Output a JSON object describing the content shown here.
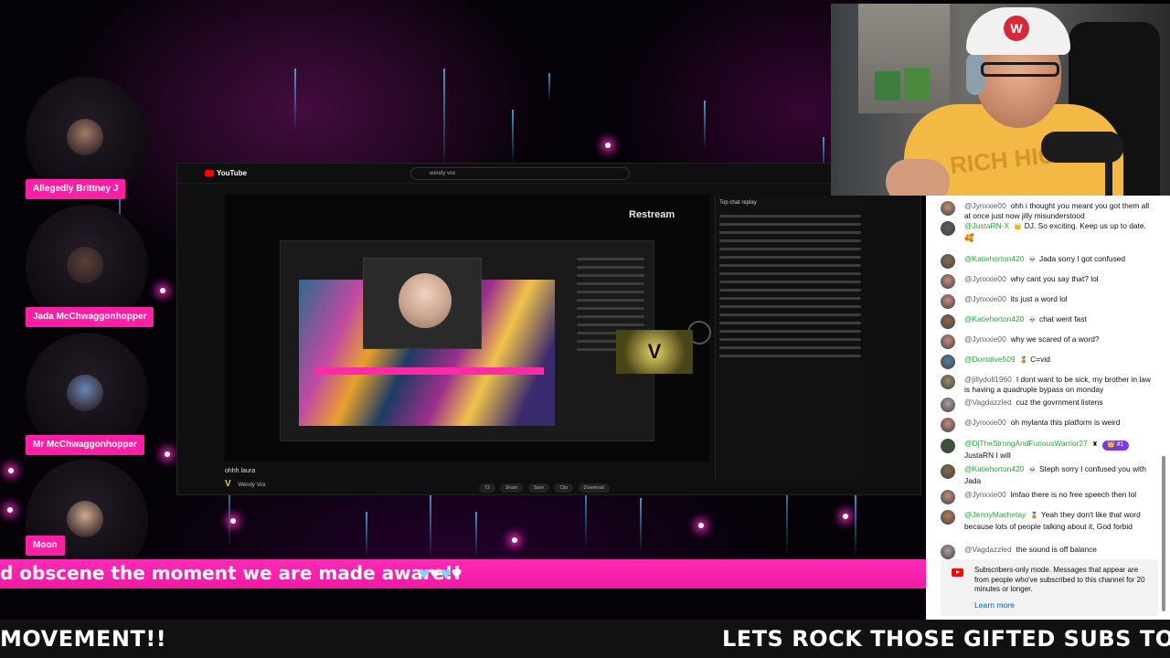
{
  "guests": [
    {
      "name": "Allegedly Brittney J",
      "face_color": "#a37b65"
    },
    {
      "name": "Jada McChwaggonhopper",
      "face_color": "#5a4038"
    },
    {
      "name": "Mr McChwaggonhopper",
      "face_color": "#6a86b8"
    },
    {
      "name": "Moon",
      "face_color": "#cfa990"
    }
  ],
  "shared_screen": {
    "app": "YouTube",
    "search_query": "wendy vox",
    "restream_label": "Restream",
    "video_caption": "ohhh laura",
    "channel_name": "Wendy Vox",
    "chat_header": "Top chat replay",
    "v_logo": "V",
    "actions": [
      "73",
      "Share",
      "Save",
      "Clip",
      "Download"
    ]
  },
  "pink_banner": {
    "text": "d obscene the moment we are made aware!!",
    "hearts": [
      "blue",
      "white",
      "blue",
      "white"
    ]
  },
  "bottom_ticker": {
    "left_text": "MOVEMENT!!",
    "right_text": "LETS ROCK THOSE GIFTED SUBS TONIG"
  },
  "webcam": {
    "cap_logo": "W",
    "shirt_text": "RICH HICK"
  },
  "chat": {
    "messages": [
      {
        "author": "@Jynxxie00",
        "member": false,
        "badge": "",
        "text": "ohh i thought you meant you got them all at once just now jilly misunderstood",
        "avatar_color": "#c68b7e"
      },
      {
        "author": "@JustaRN-X",
        "member": true,
        "badge": "👑",
        "text": "DJ. So exciting. Keep us up to date. 🥰",
        "avatar_color": "#5c5c5c"
      },
      {
        "author": "@Katiehorton420",
        "member": true,
        "badge": "💀",
        "text": "Jada sorry I got confused",
        "avatar_color": "#8a6a4c"
      },
      {
        "author": "@Jynxxie00",
        "member": false,
        "badge": "",
        "text": "why cant you say that? lol",
        "avatar_color": "#c68b7e"
      },
      {
        "author": "@Jynxxie00",
        "member": false,
        "badge": "",
        "text": "its just a word lol",
        "avatar_color": "#c68b7e"
      },
      {
        "author": "@Katiehorton420",
        "member": true,
        "badge": "💀",
        "text": "chat went fast",
        "avatar_color": "#8a6a4c"
      },
      {
        "author": "@Jynxxie00",
        "member": false,
        "badge": "",
        "text": "why we scared of a word?",
        "avatar_color": "#c68b7e"
      },
      {
        "author": "@Dontdive509",
        "member": true,
        "badge": "🥉",
        "text": "C=vid",
        "avatar_color": "#4f7fa0"
      },
      {
        "author": "@jillydoll1960",
        "member": false,
        "badge": "",
        "text": "I dont want to be sick, my brother in law is having a quadruple bypass on monday",
        "avatar_color": "#9c8c6a"
      },
      {
        "author": "@Vagdazzled",
        "member": false,
        "badge": "",
        "text": "cuz the govrnment listens",
        "avatar_color": "#b0a0a0"
      },
      {
        "author": "@Jynxxie00",
        "member": false,
        "badge": "",
        "text": "oh mylanta this platform is weird",
        "avatar_color": "#c68b7e"
      },
      {
        "author": "@DjTheStrongAndFuriousWarrior27",
        "member": true,
        "badge": "♜",
        "gift": "👑 #1",
        "text": "JustaRN I will",
        "avatar_color": "#3a5a32"
      },
      {
        "author": "@Katiehorton420",
        "member": true,
        "badge": "💀",
        "text": "Steph sorry I confused you with Jada",
        "avatar_color": "#8a6a4c"
      },
      {
        "author": "@Jynxxie00",
        "member": false,
        "badge": "",
        "text": "lmfao there is no free speech then lol",
        "avatar_color": "#c68b7e"
      },
      {
        "author": "@JennyMachetay",
        "member": true,
        "badge": "🥉",
        "text": "Yeah they don't like that word because lots of people talking about it, God forbid",
        "avatar_color": "#b07a5a"
      },
      {
        "author": "@Vagdazzled",
        "member": false,
        "badge": "",
        "text": "the sound is off balance",
        "avatar_color": "#b0a0a0"
      }
    ],
    "subscribers_notice": "Subscribers-only mode. Messages that appear are from people who've subscribed to this channel for 20 minutes or longer.",
    "learn_more": "Learn more"
  }
}
